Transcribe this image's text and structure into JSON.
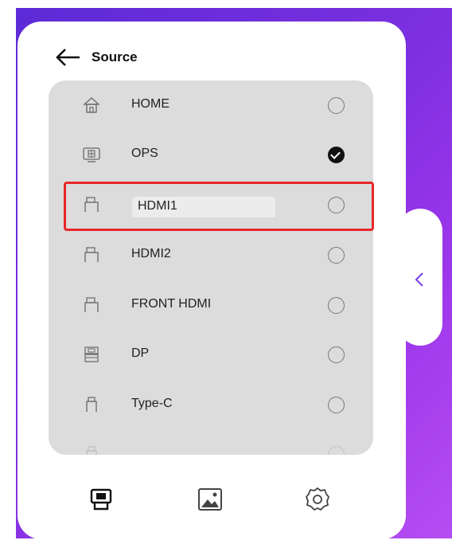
{
  "header": {
    "title": "Source",
    "back_icon": "arrow-left-icon"
  },
  "sources": [
    {
      "label": "HOME",
      "icon": "home-icon",
      "selected": false
    },
    {
      "label": "OPS",
      "icon": "ops-icon",
      "selected": true
    },
    {
      "label": "HDMI1",
      "icon": "hdmi-port-icon",
      "selected": false,
      "highlighted": true
    },
    {
      "label": "HDMI2",
      "icon": "hdmi-port-icon",
      "selected": false
    },
    {
      "label": "FRONT HDMI",
      "icon": "hdmi-port-icon",
      "selected": false
    },
    {
      "label": "DP",
      "icon": "displayport-icon",
      "selected": false
    },
    {
      "label": "Type-C",
      "icon": "usb-c-icon",
      "selected": false
    },
    {
      "label": "",
      "icon": "port-icon",
      "selected": false
    }
  ],
  "side_tab": {
    "icon": "chevron-left-icon",
    "glyph": "<"
  },
  "bottom_nav": [
    {
      "icon": "source-input-icon"
    },
    {
      "icon": "image-icon"
    },
    {
      "icon": "gear-icon"
    }
  ],
  "colors": {
    "accent": "#7b3fe4",
    "highlight_border": "#e8262a",
    "list_background": "#dcdcdc"
  }
}
